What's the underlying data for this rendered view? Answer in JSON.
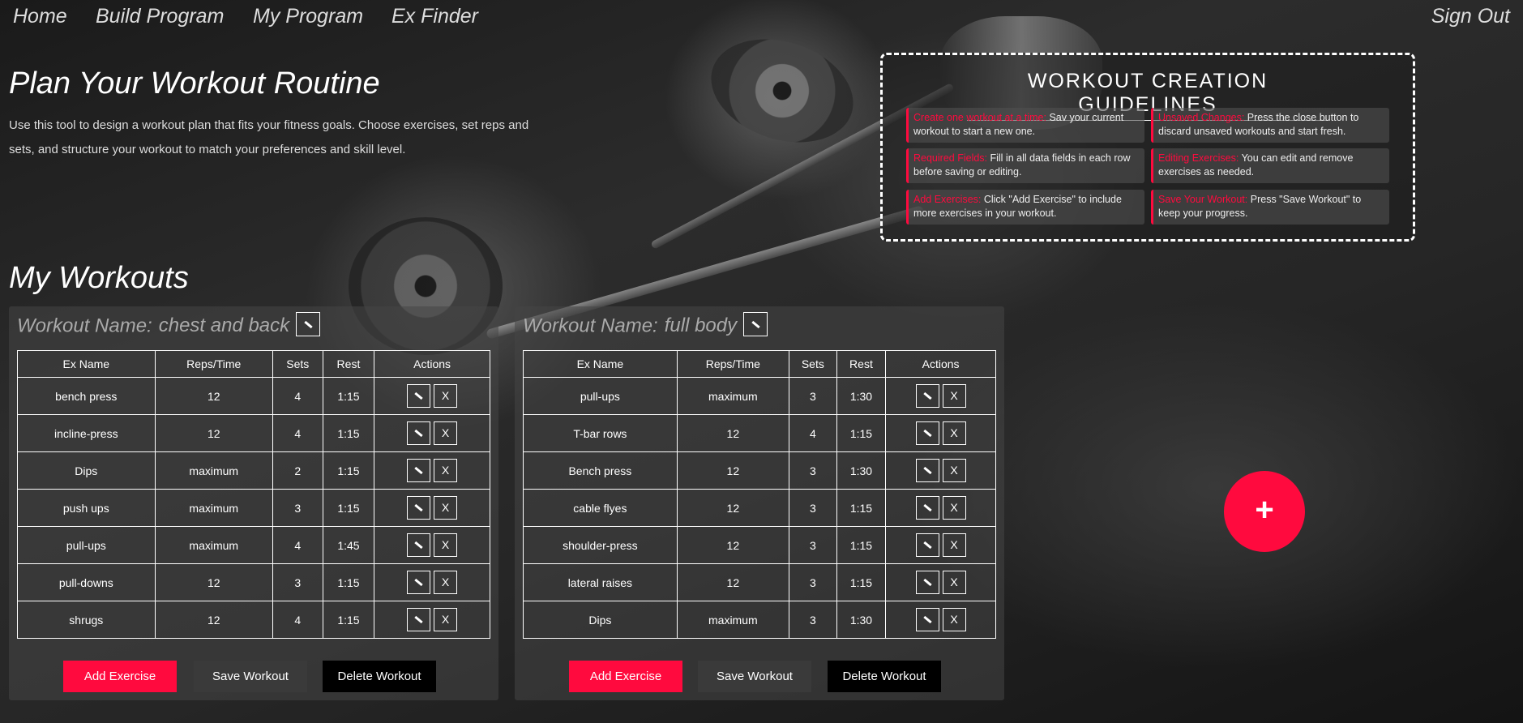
{
  "nav": {
    "home": "Home",
    "build": "Build Program",
    "myprogram": "My Program",
    "finder": "Ex Finder",
    "signout": "Sign Out"
  },
  "hero": {
    "title": "Plan Your Workout Routine",
    "intro": "Use this tool to design a workout plan that fits your fitness goals. Choose exercises, set reps and sets, and structure your workout to match your preferences and skill level."
  },
  "guidelines": {
    "title": "WORKOUT CREATION GUIDELINES",
    "items": [
      {
        "label": "Create one workout at a time:",
        "text": " Sav your current workout to start a new one."
      },
      {
        "label": "Unsaved Changes:",
        "text": " Press the close button to discard unsaved workouts and start fresh."
      },
      {
        "label": "Required Fields:",
        "text": " Fill in all data fields in each row before saving or editing."
      },
      {
        "label": "Editing Exercises:",
        "text": " You can edit and remove exercises as needed."
      },
      {
        "label": "Add Exercises:",
        "text": " Click \"Add Exercise\" to include more exercises in your workout."
      },
      {
        "label": "Save Your Workout:",
        "text": " Press \"Save Workout\" to keep your progress."
      }
    ]
  },
  "my_workouts_title": "My Workouts",
  "workout_name_label": "Workout Name:",
  "columns": [
    "Ex Name",
    "Reps/Time",
    "Sets",
    "Rest",
    "Actions"
  ],
  "delete_symbol": "X",
  "buttons": {
    "add": "Add Exercise",
    "save": "Save Workout",
    "delete": "Delete Workout"
  },
  "fab_symbol": "+",
  "accent_color": "#ff0a3e",
  "workouts": [
    {
      "name": "chest and back",
      "rows": [
        [
          "bench press",
          "12",
          "4",
          "1:15"
        ],
        [
          "incline-press",
          "12",
          "4",
          "1:15"
        ],
        [
          "Dips",
          "maximum",
          "2",
          "1:15"
        ],
        [
          "push ups",
          "maximum",
          "3",
          "1:15"
        ],
        [
          "pull-ups",
          "maximum",
          "4",
          "1:45"
        ],
        [
          "pull-downs",
          "12",
          "3",
          "1:15"
        ],
        [
          "shrugs",
          "12",
          "4",
          "1:15"
        ]
      ]
    },
    {
      "name": "full body",
      "rows": [
        [
          "pull-ups",
          "maximum",
          "3",
          "1:30"
        ],
        [
          "T-bar rows",
          "12",
          "4",
          "1:15"
        ],
        [
          "Bench press",
          "12",
          "3",
          "1:30"
        ],
        [
          "cable flyes",
          "12",
          "3",
          "1:15"
        ],
        [
          "shoulder-press",
          "12",
          "3",
          "1:15"
        ],
        [
          "lateral raises",
          "12",
          "3",
          "1:15"
        ],
        [
          "Dips",
          "maximum",
          "3",
          "1:30"
        ]
      ]
    }
  ]
}
